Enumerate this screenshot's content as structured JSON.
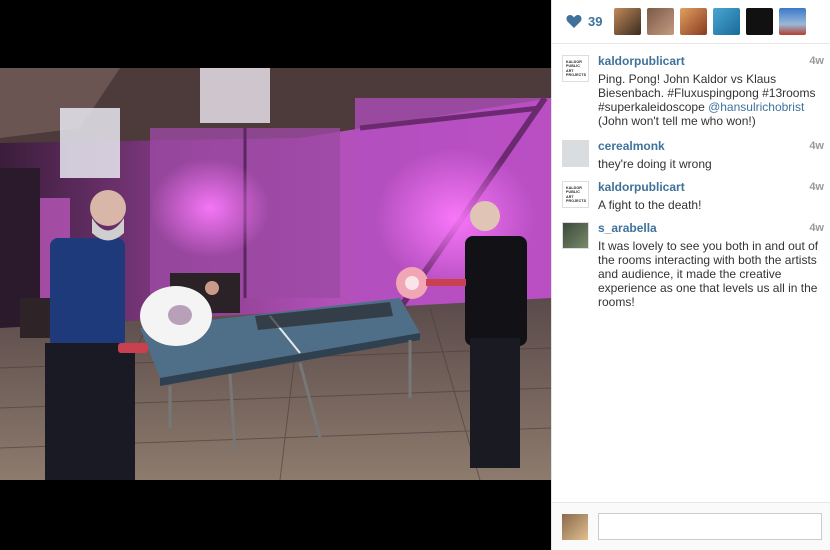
{
  "likes": {
    "count": "39",
    "icon": "heart-icon",
    "color": "#3f729b"
  },
  "comments": [
    {
      "user": "kaldorpublicart",
      "time": "4w",
      "text_parts": [
        "Ping. Pong! John Kaldor vs Klaus Biesenbach. #Fluxuspingpong #13rooms #superkaleidoscope ",
        "@hansulrichobrist",
        " (John won't tell me who won!)"
      ],
      "avatar_text": [
        "KALDOR",
        "PUBLIC",
        "ART",
        "PROJECTS"
      ]
    },
    {
      "user": "cerealmonk",
      "time": "4w",
      "text": "they're doing it wrong"
    },
    {
      "user": "kaldorpublicart",
      "time": "4w",
      "text": "A fight to the death!",
      "avatar_text": [
        "KALDOR",
        "PUBLIC",
        "ART",
        "PROJECTS"
      ]
    },
    {
      "user": "s_arabella",
      "time": "4w",
      "text": "It was lovely to see you both in and out of the rooms interacting with both the artists and audience, it made the creative experience as one that levels us all in the rooms!"
    }
  ],
  "compose": {
    "placeholder": ""
  }
}
